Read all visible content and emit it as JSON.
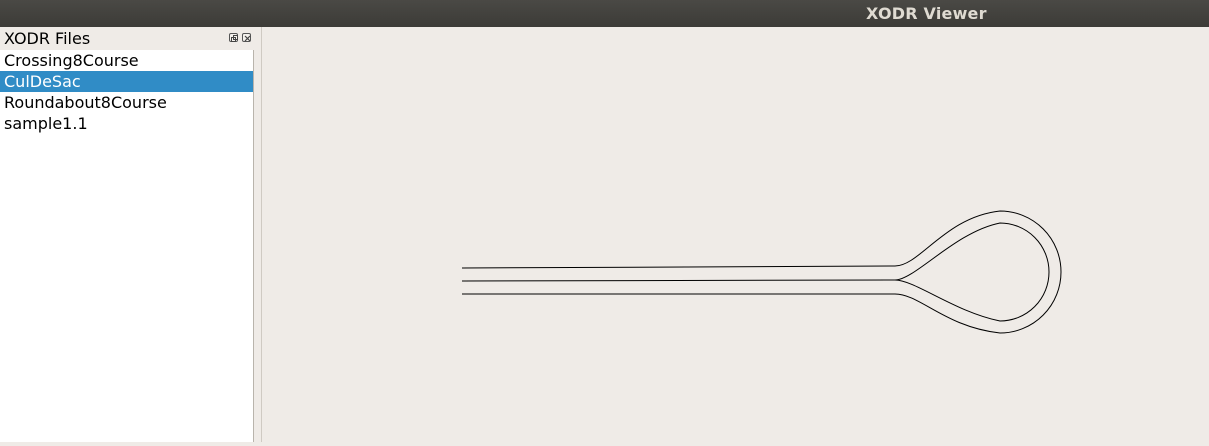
{
  "window": {
    "title": "XODR Viewer"
  },
  "dock": {
    "title": "XODR Files",
    "float_icon": "float-icon",
    "close_icon": "close-icon"
  },
  "files": {
    "items": [
      {
        "label": "Crossing8Course",
        "selected": false
      },
      {
        "label": "CulDeSac",
        "selected": true
      },
      {
        "label": "Roundabout8Course",
        "selected": false
      },
      {
        "label": "sample1.1",
        "selected": false
      }
    ]
  },
  "colors": {
    "titlebar": "#3c3b37",
    "selection": "#308cc6",
    "canvas_background": "#efebe7",
    "road_outline": "#000000"
  }
}
